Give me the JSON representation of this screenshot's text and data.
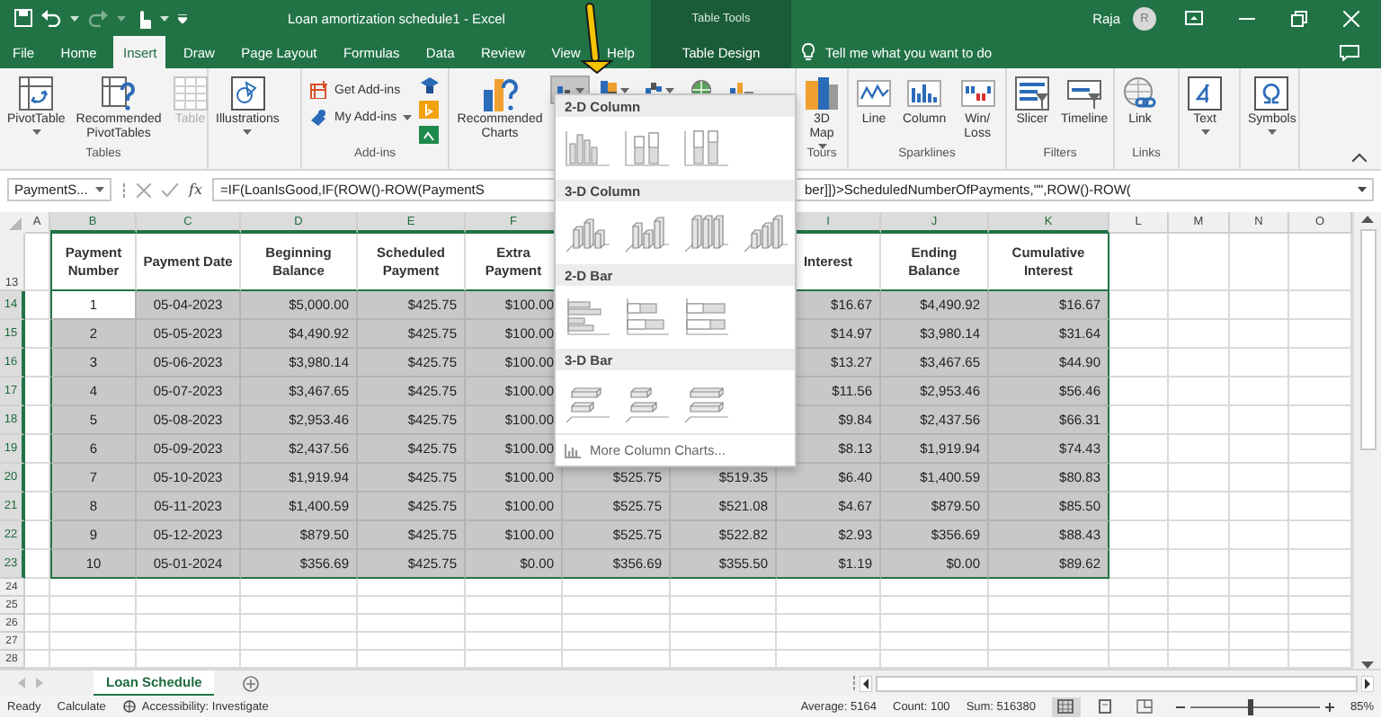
{
  "window": {
    "title": "Loan amortization schedule1 - Excel",
    "context_group": "Table Tools",
    "user": "Raja",
    "avatar_initial": "R"
  },
  "ribbon_tabs": [
    {
      "label": "File",
      "selected": false,
      "contextual": false
    },
    {
      "label": "Home",
      "selected": false,
      "contextual": false
    },
    {
      "label": "Insert",
      "selected": true,
      "contextual": false
    },
    {
      "label": "Draw",
      "selected": false,
      "contextual": false
    },
    {
      "label": "Page Layout",
      "selected": false,
      "contextual": false
    },
    {
      "label": "Formulas",
      "selected": false,
      "contextual": false
    },
    {
      "label": "Data",
      "selected": false,
      "contextual": false
    },
    {
      "label": "Review",
      "selected": false,
      "contextual": false
    },
    {
      "label": "View",
      "selected": false,
      "contextual": false
    },
    {
      "label": "Help",
      "selected": false,
      "contextual": false
    },
    {
      "label": "Table Design",
      "selected": false,
      "contextual": true
    }
  ],
  "tell_me": {
    "placeholder": "Tell me what you want to do"
  },
  "ribbon_groups": [
    {
      "label": "Tables",
      "items": [
        {
          "kind": "large",
          "label": "PivotTable",
          "dropdown": true,
          "disabled": false
        },
        {
          "kind": "large",
          "label": "Recommended PivotTables",
          "dropdown": false,
          "disabled": false
        },
        {
          "kind": "large",
          "label": "Table",
          "dropdown": false,
          "disabled": true
        }
      ]
    },
    {
      "items": [
        {
          "kind": "large",
          "label": "Illustrations",
          "dropdown": true,
          "disabled": false
        }
      ]
    },
    {
      "label": "Add-ins",
      "items": [
        {
          "kind": "small",
          "label": "Get Add-ins",
          "dropdown": false,
          "disabled": false
        },
        {
          "kind": "small",
          "label": "My Add-ins",
          "dropdown": true,
          "disabled": false
        },
        {
          "kind": "icon",
          "disabled": false
        },
        {
          "kind": "icon",
          "disabled": false
        },
        {
          "kind": "icon",
          "disabled": false
        }
      ]
    },
    {
      "items": [
        {
          "kind": "large",
          "label": "Recommended Charts",
          "dropdown": false,
          "disabled": false,
          "pressed": false
        },
        {
          "kind": "icon",
          "dropdown": true,
          "disabled": false,
          "pressed": true
        },
        {
          "kind": "icon",
          "dropdown": true,
          "disabled": false,
          "pressed": false
        },
        {
          "kind": "icon",
          "dropdown": true,
          "disabled": false,
          "pressed": false
        },
        {
          "kind": "icon",
          "dropdown": false,
          "disabled": false,
          "pressed": false
        },
        {
          "kind": "icon",
          "dropdown": false,
          "disabled": false,
          "pressed": false
        }
      ]
    },
    {
      "label": "Tours",
      "items": [
        {
          "kind": "large",
          "label": "3D Map",
          "dropdown": true,
          "disabled": false
        }
      ]
    },
    {
      "label": "Sparklines",
      "items": [
        {
          "kind": "large",
          "label": "Line",
          "dropdown": false,
          "disabled": false
        },
        {
          "kind": "large",
          "label": "Column",
          "dropdown": false,
          "disabled": false
        },
        {
          "kind": "large",
          "label": "Win/Loss",
          "dropdown": false,
          "disabled": false
        }
      ]
    },
    {
      "label": "Filters",
      "items": [
        {
          "kind": "large",
          "label": "Slicer",
          "dropdown": false,
          "disabled": false
        },
        {
          "kind": "large",
          "label": "Timeline",
          "dropdown": false,
          "disabled": false
        }
      ]
    },
    {
      "label": "Links",
      "items": [
        {
          "kind": "large",
          "label": "Link",
          "dropdown": false,
          "disabled": false
        }
      ]
    },
    {
      "items": [
        {
          "kind": "large",
          "label": "Text",
          "dropdown": true,
          "disabled": false
        }
      ]
    },
    {
      "items": [
        {
          "kind": "large",
          "label": "Symbols",
          "dropdown": true,
          "disabled": false
        }
      ]
    }
  ],
  "formula_bar": {
    "name_box": "PaymentS...",
    "function_label": "fx",
    "formula_start": "=IF(LoanIsGood,IF(ROW()-ROW(PaymentS",
    "formula_end": "ber]])>ScheduledNumberOfPayments,\"\",ROW()-ROW("
  },
  "chart_menu": {
    "sections": [
      {
        "kind": "column-2d",
        "title": "2-D Column",
        "options": [
          {
            "selected": false
          },
          {
            "selected": false
          },
          {
            "selected": false
          }
        ]
      },
      {
        "kind": "column-3d",
        "title": "3-D Column",
        "options": [
          {
            "selected": false
          },
          {
            "selected": false
          },
          {
            "selected": false
          },
          {
            "selected": false
          }
        ]
      },
      {
        "kind": "bar-2d",
        "title": "2-D Bar",
        "options": [
          {
            "selected": false
          },
          {
            "selected": false
          },
          {
            "selected": false
          }
        ]
      },
      {
        "kind": "bar-3d",
        "title": "3-D Bar",
        "options": [
          {
            "selected": false
          },
          {
            "selected": false
          },
          {
            "selected": false
          }
        ]
      }
    ],
    "more_link": "More Column Charts..."
  },
  "sheet": {
    "column_letters_left": [
      {
        "label": "A",
        "selected": false
      },
      {
        "label": "B",
        "selected": true
      },
      {
        "label": "C",
        "selected": true
      },
      {
        "label": "D",
        "selected": true
      },
      {
        "label": "E",
        "selected": true
      },
      {
        "label": "F",
        "selected": true
      }
    ],
    "column_letters_right": [
      {
        "label": "I",
        "selected": true
      },
      {
        "label": "J",
        "selected": true
      },
      {
        "label": "K",
        "selected": true
      },
      {
        "label": "L",
        "selected": false
      },
      {
        "label": "M",
        "selected": false
      },
      {
        "label": "N",
        "selected": false
      },
      {
        "label": "O",
        "selected": false
      }
    ],
    "header_row": {
      "number": "13",
      "cells": [
        "Payment Number",
        "Payment Date",
        "Beginning Balance",
        "Scheduled Payment",
        "Extra Payment",
        null,
        null,
        "Interest",
        "Ending Balance",
        "Cumulative Interest"
      ]
    },
    "rows": [
      {
        "number": "14",
        "selected": true,
        "active": true,
        "cells": [
          "1",
          "05-04-2023",
          "$5,000.00",
          "$425.75",
          "$100.00",
          null,
          null,
          "$16.67",
          "$4,490.92",
          "$16.67"
        ]
      },
      {
        "number": "15",
        "selected": true,
        "active": false,
        "cells": [
          "2",
          "05-05-2023",
          "$4,490.92",
          "$425.75",
          "$100.00",
          null,
          null,
          "$14.97",
          "$3,980.14",
          "$31.64"
        ]
      },
      {
        "number": "16",
        "selected": true,
        "active": false,
        "cells": [
          "3",
          "05-06-2023",
          "$3,980.14",
          "$425.75",
          "$100.00",
          null,
          null,
          "$13.27",
          "$3,467.65",
          "$44.90"
        ]
      },
      {
        "number": "17",
        "selected": true,
        "active": false,
        "cells": [
          "4",
          "05-07-2023",
          "$3,467.65",
          "$425.75",
          "$100.00",
          null,
          null,
          "$11.56",
          "$2,953.46",
          "$56.46"
        ]
      },
      {
        "number": "18",
        "selected": true,
        "active": false,
        "cells": [
          "5",
          "05-08-2023",
          "$2,953.46",
          "$425.75",
          "$100.00",
          null,
          null,
          "$9.84",
          "$2,437.56",
          "$66.31"
        ]
      },
      {
        "number": "19",
        "selected": true,
        "active": false,
        "cells": [
          "6",
          "05-09-2023",
          "$2,437.56",
          "$425.75",
          "$100.00",
          null,
          null,
          "$8.13",
          "$1,919.94",
          "$74.43"
        ]
      },
      {
        "number": "20",
        "selected": true,
        "active": false,
        "cells": [
          "7",
          "05-10-2023",
          "$1,919.94",
          "$425.75",
          "$100.00",
          "$525.75",
          "$519.35",
          "$6.40",
          "$1,400.59",
          "$80.83"
        ]
      },
      {
        "number": "21",
        "selected": true,
        "active": false,
        "cells": [
          "8",
          "05-11-2023",
          "$1,400.59",
          "$425.75",
          "$100.00",
          "$525.75",
          "$521.08",
          "$4.67",
          "$879.50",
          "$85.50"
        ]
      },
      {
        "number": "22",
        "selected": true,
        "active": false,
        "cells": [
          "9",
          "05-12-2023",
          "$879.50",
          "$425.75",
          "$100.00",
          "$525.75",
          "$522.82",
          "$2.93",
          "$356.69",
          "$88.43"
        ]
      },
      {
        "number": "23",
        "selected": true,
        "active": false,
        "cells": [
          "10",
          "05-01-2024",
          "$356.69",
          "$425.75",
          "$0.00",
          "$356.69",
          "$355.50",
          "$1.19",
          "$0.00",
          "$89.62"
        ]
      }
    ],
    "blank_rows": [
      "24",
      "25",
      "26",
      "27",
      "28"
    ]
  },
  "sheet_tabs": [
    {
      "label": "Loan Schedule",
      "selected": true
    }
  ],
  "status_bar": {
    "left": [
      "Ready",
      "Calculate"
    ],
    "accessibility": "Accessibility: Investigate",
    "stats": [
      "Average: 5164",
      "Count: 100",
      "Sum: 516380"
    ],
    "views": [
      {
        "selected": true
      },
      {
        "selected": false
      },
      {
        "selected": false
      }
    ],
    "zoom": {
      "level": 0.47,
      "reading": "85%"
    }
  }
}
